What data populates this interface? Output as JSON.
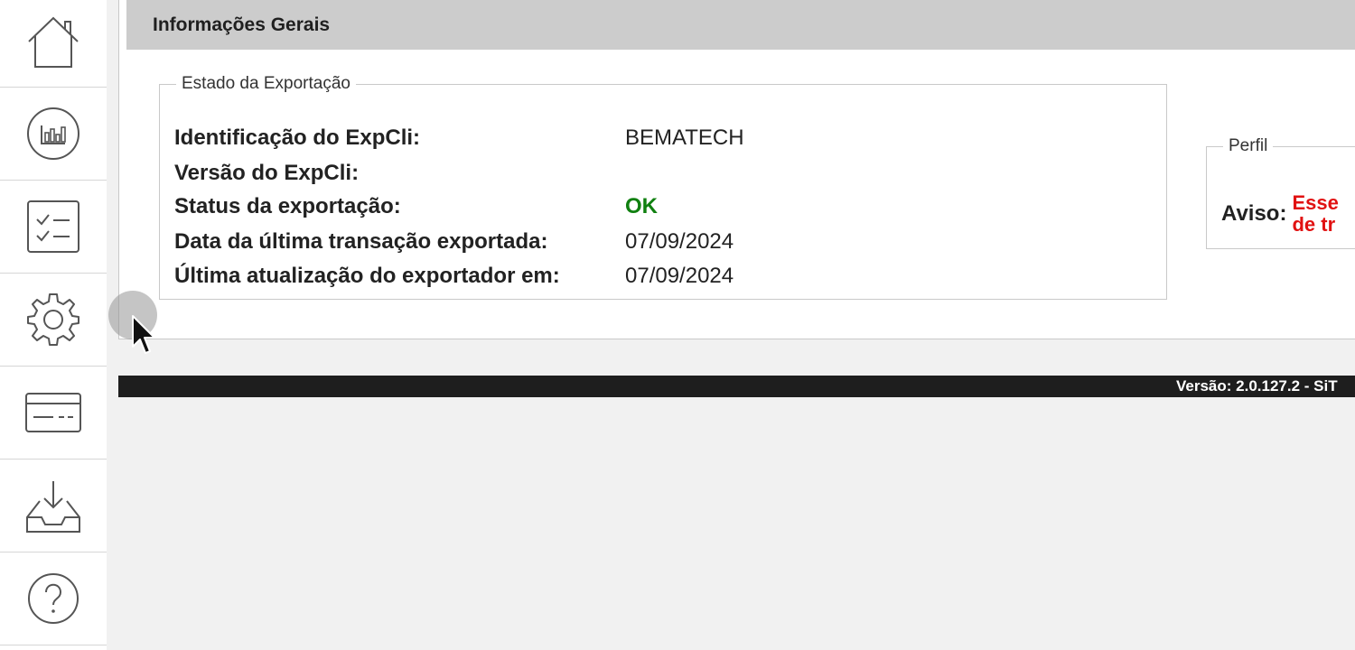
{
  "sidebar": {
    "items": [
      {
        "icon": "home-icon"
      },
      {
        "icon": "chart-icon"
      },
      {
        "icon": "checklist-icon"
      },
      {
        "icon": "gear-icon"
      },
      {
        "icon": "card-icon"
      },
      {
        "icon": "download-tray-icon"
      },
      {
        "icon": "help-icon"
      }
    ]
  },
  "panel": {
    "title": "Informações Gerais",
    "estado": {
      "legend": "Estado da Exportação",
      "rows": [
        {
          "label": "Identificação do ExpCli:",
          "value": "BEMATECH"
        },
        {
          "label": "Versão do ExpCli:",
          "value": ""
        },
        {
          "label": "Status da exportação:",
          "value": "OK"
        },
        {
          "label": "Data da última transação exportada:",
          "value": "07/09/2024"
        },
        {
          "label": "Última atualização do exportador em:",
          "value": "07/09/2024"
        }
      ]
    },
    "perfil": {
      "legend": "Perfil",
      "aviso_label": "Aviso:",
      "aviso_line1": "Esse",
      "aviso_line2": "de tr"
    }
  },
  "footer": {
    "version": "Versão: 2.0.127.2 - SiT"
  },
  "colors": {
    "ok": "#108010",
    "warning": "#e11111",
    "header_bg": "#cccccc",
    "footer_bg": "#1e1e1e"
  }
}
